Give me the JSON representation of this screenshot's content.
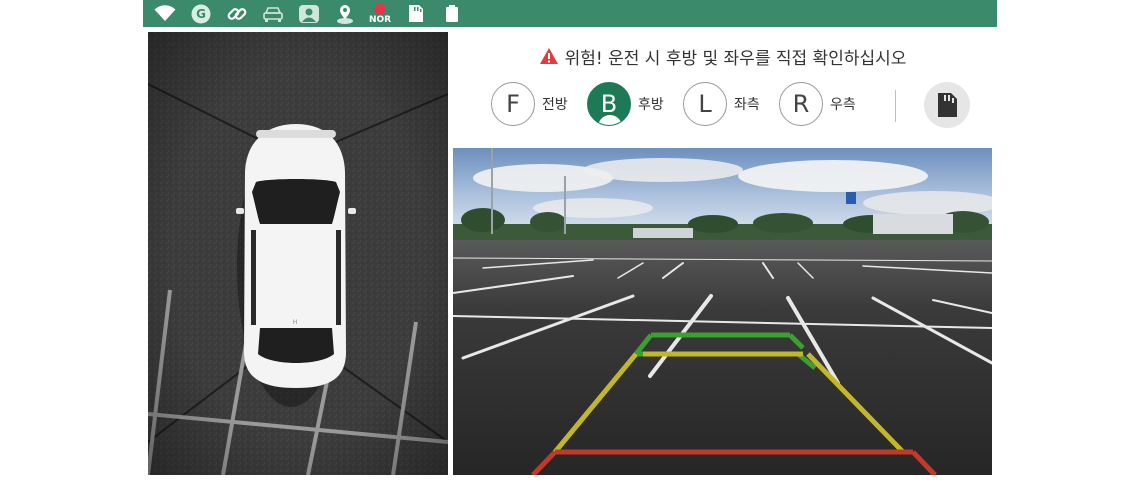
{
  "status_bar": {
    "icons": [
      "wifi-icon",
      "g-badge-icon",
      "link-icon",
      "car-icon",
      "driver-icon",
      "location-icon",
      "record-icon",
      "sd-card-icon",
      "memory-card-icon"
    ],
    "g_badge_text": "G",
    "record_mode_text": "NOR",
    "background_color": "#3b8a6c"
  },
  "warning": {
    "text": "위험! 운전 시 후방 및 좌우를 직접 확인하십시오",
    "icon": "warning-triangle-icon",
    "icon_color": "#e03c3c"
  },
  "view_modes": [
    {
      "letter": "F",
      "label": "전방",
      "active": false
    },
    {
      "letter": "B",
      "label": "후방",
      "active": true
    },
    {
      "letter": "L",
      "label": "좌측",
      "active": false
    },
    {
      "letter": "R",
      "label": "우측",
      "active": false
    }
  ],
  "active_color": "#1e7a56",
  "sd_button": {
    "icon": "sd-card-icon"
  },
  "top_view": {
    "license_plate_text": "H"
  },
  "rear_view": {
    "guide_colors": {
      "far": "#3aa02f",
      "mid": "#c2b62a",
      "near": "#c0392b"
    }
  }
}
